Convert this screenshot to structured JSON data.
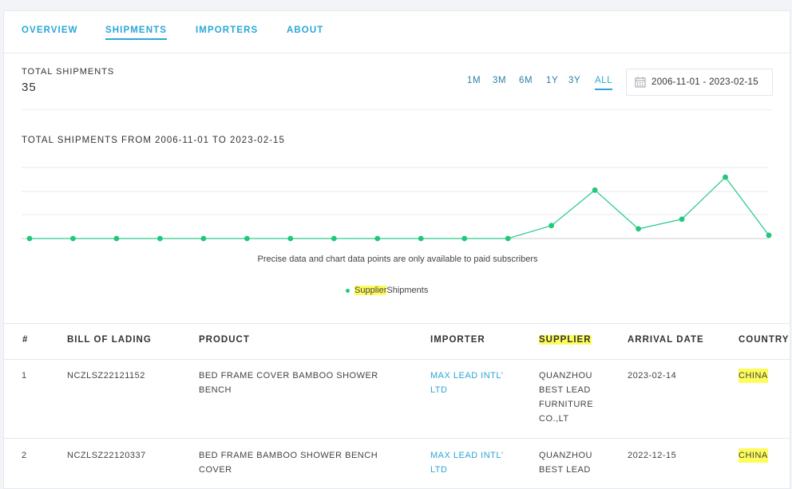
{
  "tabs": [
    "OVERVIEW",
    "SHIPMENTS",
    "IMPORTERS",
    "ABOUT"
  ],
  "active_tab": "SHIPMENTS",
  "summary": {
    "label": "TOTAL SHIPMENTS",
    "value": "35"
  },
  "ranges": [
    "1M",
    "3M",
    "6M",
    "1Y",
    "3Y",
    "ALL"
  ],
  "active_range": "ALL",
  "date_range": "2006-11-01 - 2023-02-15",
  "chart_title": "TOTAL SHIPMENTS FROM 2006-11-01 TO 2023-02-15",
  "chart_note": "Precise data and chart data points are only available to paid subscribers",
  "legend": {
    "highlight": "Supplier",
    "rest": "Shipments"
  },
  "chart_data": {
    "type": "line",
    "title": "TOTAL SHIPMENTS FROM 2006-11-01 TO 2023-02-15",
    "series": [
      {
        "name": "Supplier Shipments",
        "values": [
          0,
          0,
          0,
          0,
          0,
          0,
          0,
          0,
          0,
          0,
          0,
          0,
          2,
          7.5,
          1.5,
          3,
          9.5,
          0.5
        ]
      }
    ],
    "ylim": [
      0,
      11
    ],
    "grid": true,
    "legend_position": "bottom",
    "color": "#2ecc8f"
  },
  "table": {
    "columns": [
      "#",
      "BILL OF LADING",
      "PRODUCT",
      "IMPORTER",
      "SUPPLIER",
      "ARRIVAL DATE",
      "COUNTRY"
    ],
    "rows": [
      {
        "num": "1",
        "bol": "NCZLSZ22121152",
        "product": [
          "BED FRAME COVER BAMBOO SHOWER",
          "BENCH"
        ],
        "importer": [
          "MAX LEAD INTL'",
          "LTD"
        ],
        "supplier": [
          "QUANZHOU",
          "BEST LEAD",
          "FURNITURE",
          "CO.,LT"
        ],
        "arrival": "2023-02-14",
        "country": "CHINA"
      },
      {
        "num": "2",
        "bol": "NCZLSZ22120337",
        "product": [
          "BED FRAME BAMBOO SHOWER BENCH",
          "COVER"
        ],
        "importer": [
          "MAX LEAD INTL'",
          "LTD"
        ],
        "supplier": [
          "QUANZHOU",
          "BEST LEAD"
        ],
        "arrival": "2022-12-15",
        "country": "CHINA"
      }
    ]
  },
  "colors": {
    "accent": "#2aa7d6",
    "line": "#2ecc8f",
    "highlight": "#fdfc5b"
  },
  "icons": {
    "date": "calendar-icon"
  }
}
